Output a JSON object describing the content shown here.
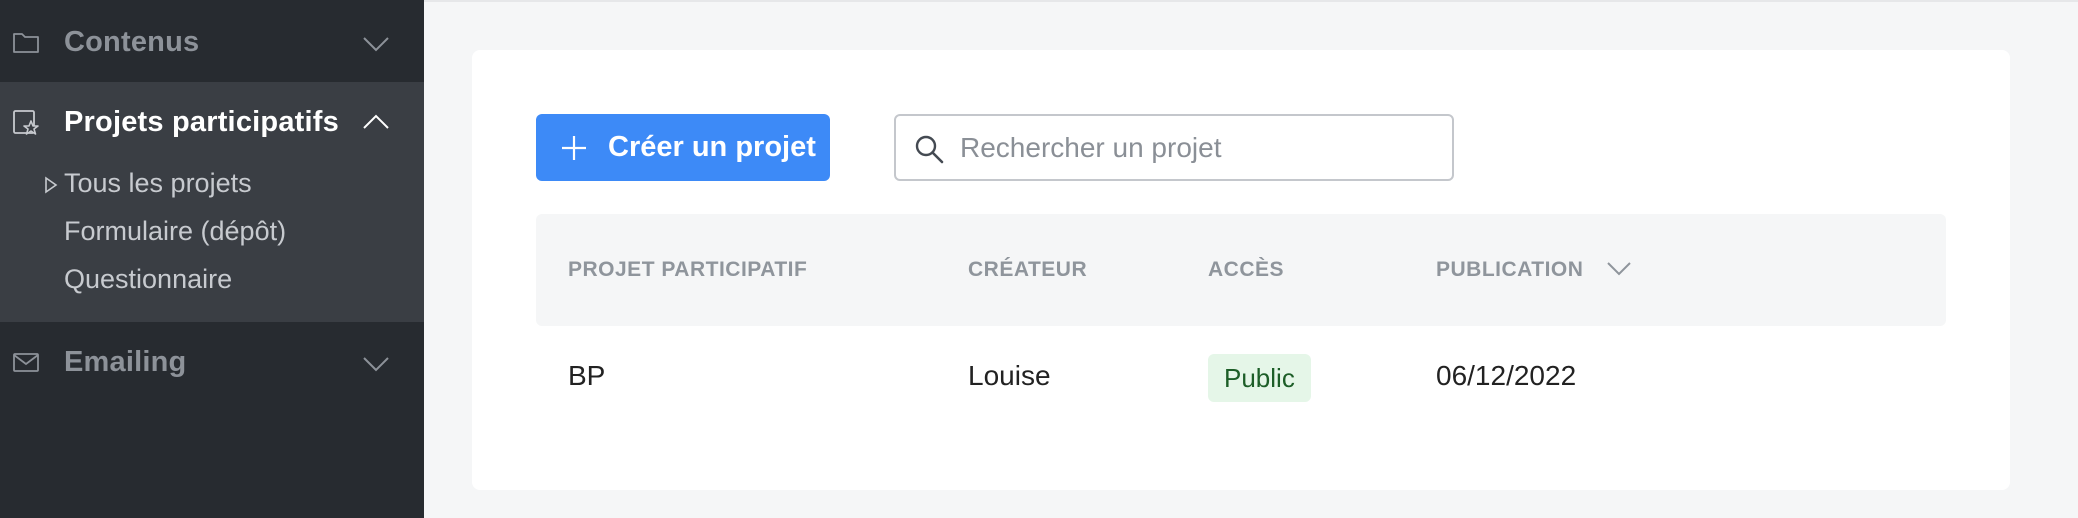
{
  "sidebar": {
    "sections": [
      {
        "label": "Contenus",
        "icon": "folder-icon",
        "expanded": false
      },
      {
        "label": "Projets participatifs",
        "icon": "projects-star-icon",
        "expanded": true,
        "items": [
          {
            "label": "Tous les projets",
            "active": true
          },
          {
            "label": "Formulaire (dépôt)"
          },
          {
            "label": "Questionnaire"
          }
        ]
      },
      {
        "label": "Emailing",
        "icon": "envelope-icon",
        "expanded": false
      }
    ]
  },
  "toolbar": {
    "create_label": "Créer un projet",
    "search_placeholder": "Rechercher un projet"
  },
  "table": {
    "columns": [
      "PROJET PARTICIPATIF",
      "CRÉATEUR",
      "ACCÈS",
      "PUBLICATION"
    ],
    "rows": [
      {
        "project": "BP",
        "creator": "Louise",
        "access": "Public",
        "publication": "06/12/2022"
      }
    ]
  },
  "colors": {
    "sidebar_bg": "#272b30",
    "sidebar_open_bg": "#3a3e44",
    "primary": "#3d8af7",
    "badge_bg": "#e5f6e8",
    "badge_text": "#1d5e28"
  }
}
